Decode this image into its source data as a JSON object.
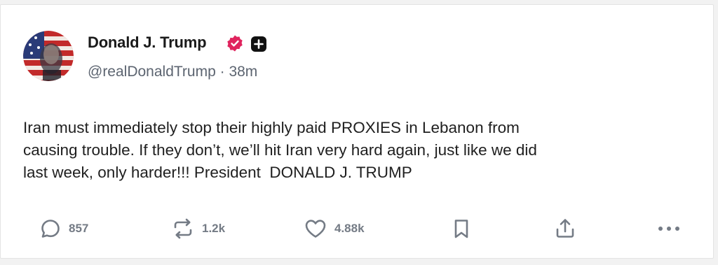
{
  "post": {
    "author_name": "Donald J. Trump",
    "handle": "@realDonaldTrump",
    "separator": " · ",
    "time_ago": "38m",
    "text": "Iran must immediately stop their highly paid PROXIES in Lebanon from\ncausing trouble. If they don’t, we’ll hit Iran very hard again, just like we did\nlast week, only harder!!! President  DONALD J. TRUMP",
    "verified_icon": "verified-badge-icon",
    "verified_color": "#e0245e"
  },
  "actions": {
    "replies": "857",
    "reposts": "1.2k",
    "likes": "4.88k"
  },
  "colors": {
    "text": "#1f1f1f",
    "muted": "#5c6470",
    "icon": "#747b85",
    "background": "#ffffff"
  }
}
